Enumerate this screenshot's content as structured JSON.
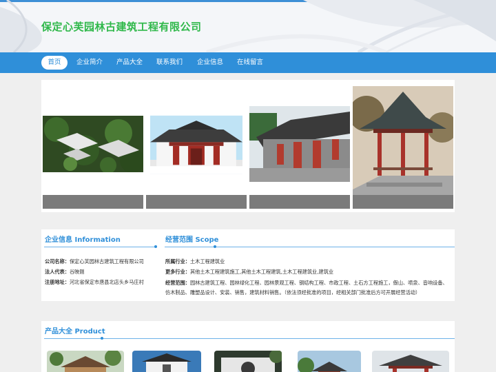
{
  "header": {
    "title": "保定心芙园林古建筑工程有限公司"
  },
  "nav": {
    "items": [
      {
        "label": "首页",
        "active": true
      },
      {
        "label": "企业简介",
        "active": false
      },
      {
        "label": "产品大全",
        "active": false
      },
      {
        "label": "联系我们",
        "active": false
      },
      {
        "label": "企业信息",
        "active": false
      },
      {
        "label": "在线留言",
        "active": false
      }
    ]
  },
  "info": {
    "title": "企业信息 Information",
    "company_label": "公司名称：",
    "company_value": "保定心芙园林古建筑工程有限公司",
    "rep_label": "法人代表：",
    "rep_value": "谷映刚",
    "addr_label": "注册地址：",
    "addr_value": "河北省保定市唐县北店头乡马庄村"
  },
  "scope": {
    "title": "经营范围 Scope",
    "industry_label": "所属行业：",
    "industry_value": "土木工程建筑业",
    "more_label": "更多行业：",
    "more_value": "其他土木工程建筑施工,其他土木工程建筑,土木工程建筑业,建筑业",
    "scope_label": "经营范围：",
    "scope_value": "园林古建筑工程、园林绿化工程、园林景观工程、钢结构工程、市政工程、土石方工程施工，假山、喷泉、音响设备、仿木制品、雕塑品设计、安装、销售，建筑材料销售。（依法须经批准的项目，经相关部门批准后方可开展经营活动）"
  },
  "products": {
    "title": "产品大全 Product"
  }
}
